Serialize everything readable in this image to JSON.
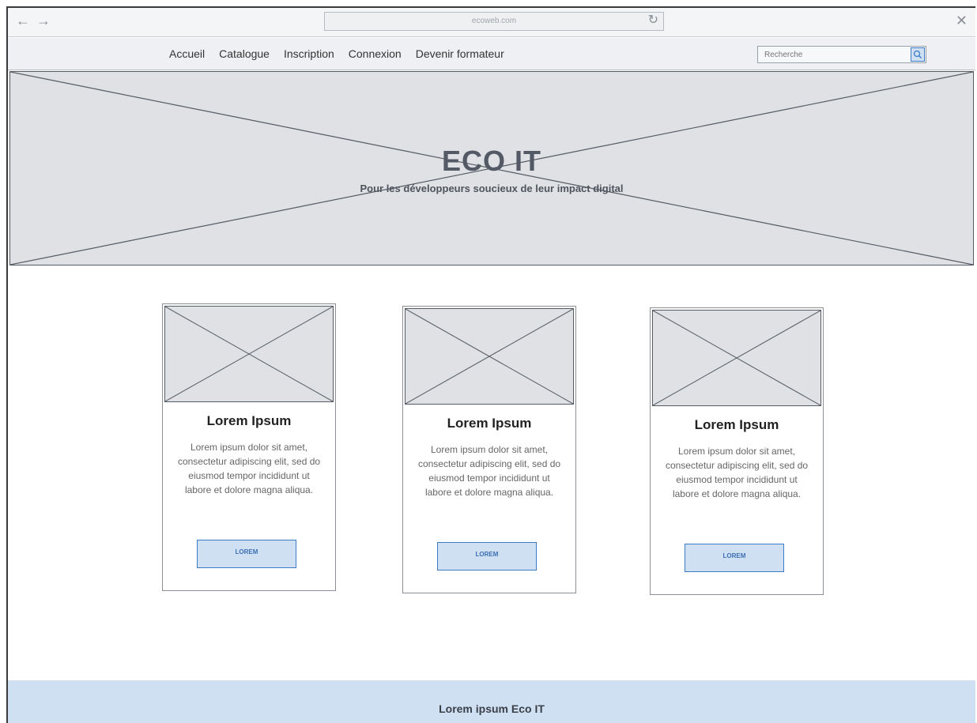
{
  "browser": {
    "back_icon": "arrow-left-icon",
    "forward_icon": "arrow-right-icon",
    "back_glyph": "←",
    "forward_glyph": "→",
    "url": "ecoweb.com",
    "reload_glyph": "↻",
    "close_glyph": "✕"
  },
  "nav": {
    "items": [
      {
        "label": "Accueil"
      },
      {
        "label": "Catalogue"
      },
      {
        "label": "Inscription"
      },
      {
        "label": "Connexion"
      },
      {
        "label": "Devenir formateur"
      }
    ],
    "search_placeholder": "Recherche",
    "search_icon": "search-icon"
  },
  "hero": {
    "title": "ECO IT",
    "subtitle": "Pour les développeurs soucieux de leur impact digital"
  },
  "cards": [
    {
      "title": "Lorem Ipsum",
      "text": "Lorem ipsum dolor sit amet, consectetur adipiscing elit, sed do eiusmod tempor incididunt ut labore et dolore magna aliqua.",
      "button": "LOREM"
    },
    {
      "title": "Lorem Ipsum",
      "text": "Lorem ipsum dolor sit amet, consectetur adipiscing elit, sed do eiusmod tempor incididunt ut labore et dolore magna aliqua.",
      "button": "LOREM"
    },
    {
      "title": "Lorem Ipsum",
      "text": "Lorem ipsum dolor sit amet, consectetur adipiscing elit, sed do eiusmod tempor incididunt ut labore et dolore magna aliqua.",
      "button": "LOREM"
    }
  ],
  "footer": {
    "text": "Lorem ipsum Eco IT"
  },
  "colors": {
    "accent": "#3b7bc8",
    "accent_fill": "#cfe0f3",
    "placeholder_fill": "#dfe1e5"
  }
}
